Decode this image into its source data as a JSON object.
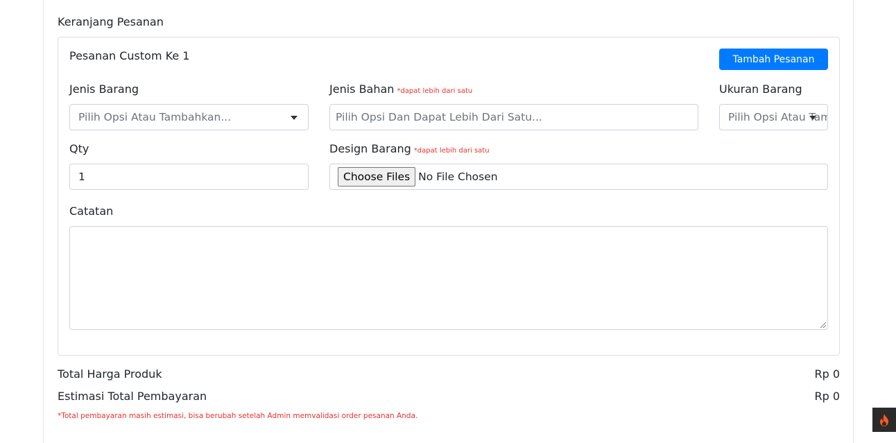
{
  "cart": {
    "title": "Keranjang Pesanan",
    "order_title": "Pesanan Custom Ke 1",
    "add_button": "Tambah Pesanan"
  },
  "fields": {
    "item_type": {
      "label": "Jenis Barang",
      "placeholder": "Pilih Opsi Atau Tambahkan..."
    },
    "material": {
      "label": "Jenis Bahan",
      "hint": "*dapat lebih dari satu",
      "placeholder": "Pilih Opsi Dan Dapat Lebih Dari Satu..."
    },
    "size": {
      "label": "Ukuran Barang",
      "placeholder": "Pilih Opsi Atau Tambahkan..."
    },
    "qty": {
      "label": "Qty",
      "value": "1"
    },
    "design": {
      "label": "Design Barang",
      "hint": "*dapat lebih dari satu",
      "button": "Choose Files",
      "status": "No File Chosen"
    },
    "notes": {
      "label": "Catatan",
      "value": ""
    }
  },
  "summary": {
    "product_total_label": "Total Harga Produk",
    "product_total_value": "Rp 0",
    "payment_label": "Estimasi Total Pembayaran",
    "payment_value": "Rp 0",
    "note": "*Total pembayaran masih estimasi, bisa berubah setelah Admin memvalidasi order pesanan Anda."
  },
  "colors": {
    "primary": "#007bff",
    "danger": "#e3342f",
    "badge": "#2b2b2b",
    "flame": "#ff5a1f"
  },
  "icons": {
    "select_caret": "caret-down-icon",
    "corner": "flame-icon"
  }
}
